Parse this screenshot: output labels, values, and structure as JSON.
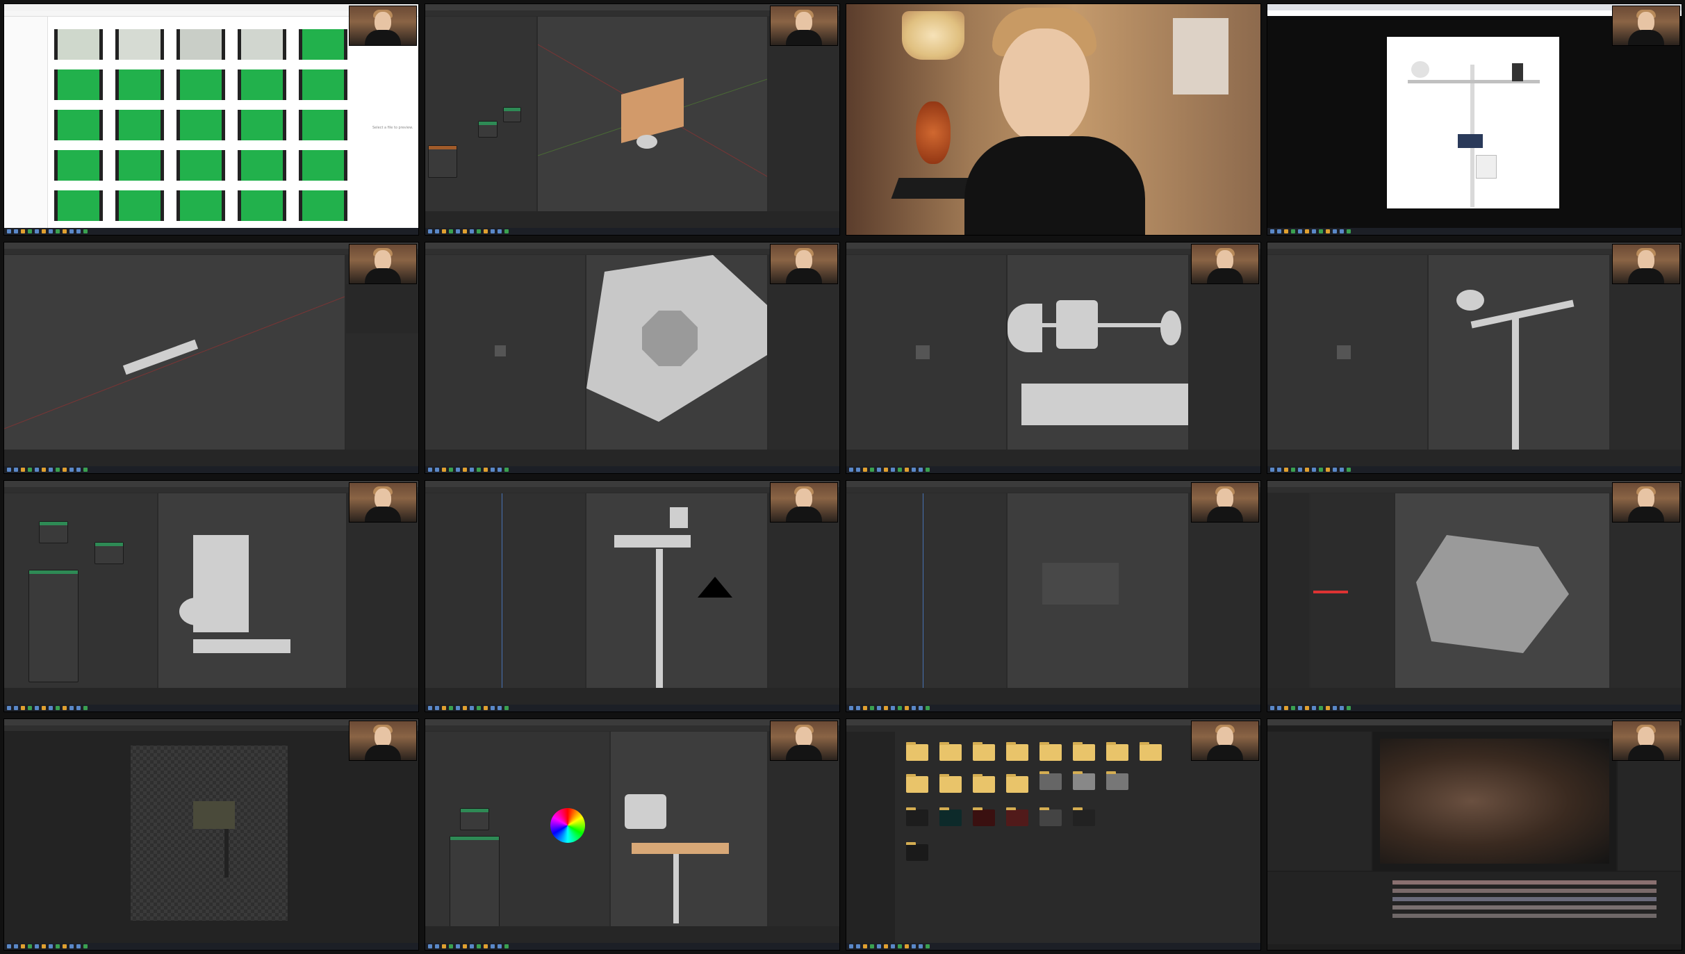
{
  "tiles": [
    {
      "id": "file-explorer-greenscreen",
      "title": "",
      "kind": "explorer",
      "side_note": "Select a file to preview."
    },
    {
      "id": "blender-shading-plane",
      "title": "",
      "kind": "blender"
    },
    {
      "id": "webcam-fullscreen",
      "title": "",
      "kind": "webcam"
    },
    {
      "id": "browser-weather-station",
      "title": "",
      "kind": "browser"
    },
    {
      "id": "blender-bar-model",
      "title": "",
      "kind": "blender"
    },
    {
      "id": "blender-octagon-closeup",
      "title": "",
      "kind": "blender"
    },
    {
      "id": "blender-anemometer",
      "title": "",
      "kind": "blender"
    },
    {
      "id": "blender-weather-station",
      "title": "",
      "kind": "blender"
    },
    {
      "id": "blender-node-setup",
      "title": "",
      "kind": "blender"
    },
    {
      "id": "blender-pole-assembly",
      "title": "",
      "kind": "blender"
    },
    {
      "id": "blender-empty-view",
      "title": "",
      "kind": "blender"
    },
    {
      "id": "blender-robot-scene",
      "title": "",
      "kind": "blender"
    },
    {
      "id": "render-window",
      "title": "",
      "kind": "render"
    },
    {
      "id": "blender-color-picker",
      "title": "",
      "kind": "blender"
    },
    {
      "id": "blender-asset-browser",
      "title": "",
      "kind": "files"
    },
    {
      "id": "compositor-video-edit",
      "title": "",
      "kind": "editor"
    }
  ],
  "colors": {
    "background": "#111111",
    "blender_viewport": "#3d3d3d",
    "greenscreen": "#22b14c",
    "folder": "#e9c46a",
    "accent": "#4772b3"
  }
}
